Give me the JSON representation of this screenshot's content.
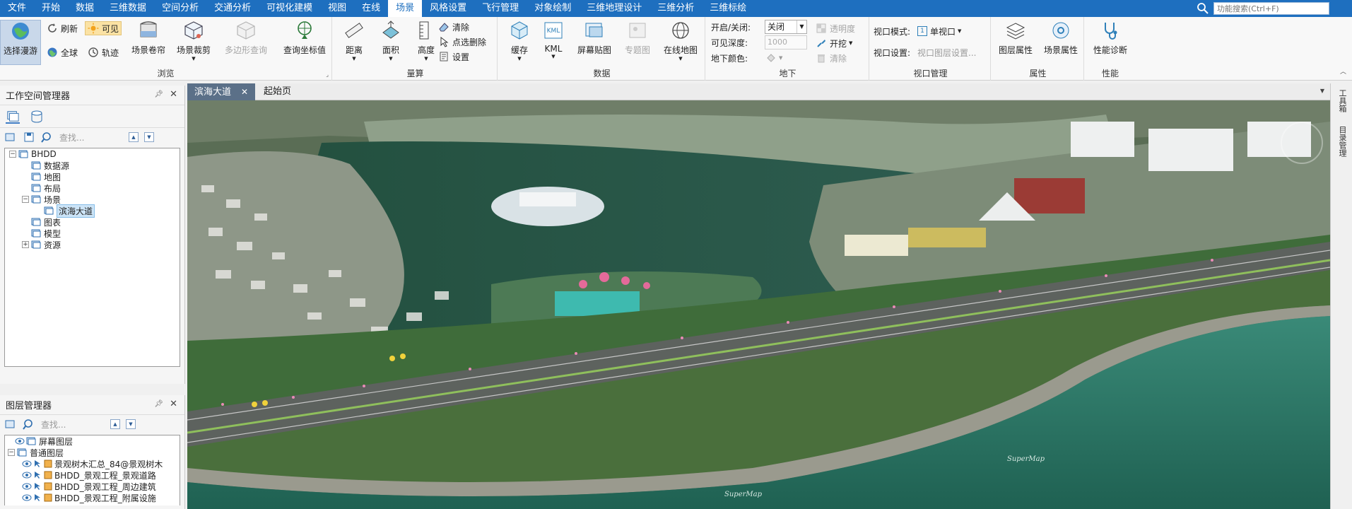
{
  "menubar": {
    "items": [
      "文件",
      "开始",
      "数据",
      "三维数据",
      "空间分析",
      "交通分析",
      "可视化建模",
      "视图",
      "在线",
      "场景",
      "风格设置",
      "飞行管理",
      "对象绘制",
      "三维地理设计",
      "三维分析",
      "三维标绘"
    ],
    "active": "场景",
    "search_placeholder": "功能搜索(Ctrl+F)"
  },
  "ribbon": {
    "browse": {
      "label": "浏览",
      "select_roam": "选择漫游",
      "refresh": "刷新",
      "visible": "可见",
      "full_extent": "全球",
      "track": "轨迹",
      "scene_roll": "场景卷帘",
      "scene_clip": "场景裁剪",
      "polygon_query": "多边形查询",
      "query_coord": "查询坐标值"
    },
    "measure": {
      "label": "量算",
      "distance": "距离",
      "area": "面积",
      "height": "高度",
      "clear": "清除",
      "point_delete": "点选删除",
      "settings": "设置"
    },
    "data": {
      "label": "数据",
      "cache": "缓存",
      "kml": "KML",
      "screen_map": "屏幕贴图",
      "theme_map": "专题图",
      "online_map": "在线地图"
    },
    "underground": {
      "label": "地下",
      "onoff_label": "开启/关闭:",
      "onoff_value": "关闭",
      "depth_label": "可见深度:",
      "depth_value": "1000",
      "color_label": "地下颜色:",
      "transparency": "透明度",
      "excavate": "开挖",
      "clear": "清除"
    },
    "viewport": {
      "label": "视口管理",
      "mode_label": "视口模式:",
      "mode_value": "单视口",
      "settings_label": "视口设置:",
      "settings_value": "视口图层设置..."
    },
    "properties": {
      "label": "属性",
      "layer_props": "图层属性",
      "scene_props": "场景属性"
    },
    "performance": {
      "label": "性能",
      "diagnose": "性能诊断"
    }
  },
  "workspace": {
    "title": "工作空间管理器",
    "find_placeholder": "查找...",
    "tree": [
      {
        "label": "BHDD",
        "level": 0,
        "expander": "−"
      },
      {
        "label": "数据源",
        "level": 1
      },
      {
        "label": "地图",
        "level": 1
      },
      {
        "label": "布局",
        "level": 1
      },
      {
        "label": "场景",
        "level": 1,
        "expander": "−"
      },
      {
        "label": "滨海大道",
        "level": 2,
        "selected": true
      },
      {
        "label": "图表",
        "level": 1
      },
      {
        "label": "模型",
        "level": 1
      },
      {
        "label": "资源",
        "level": 1,
        "expander": "+"
      }
    ]
  },
  "layers": {
    "title": "图层管理器",
    "find_placeholder": "查找...",
    "items": [
      {
        "label": "屏幕图层",
        "level": 1
      },
      {
        "label": "普通图层",
        "level": 0,
        "expander": "−"
      },
      {
        "label": "景观树木汇总_84@景观树木",
        "level": 2
      },
      {
        "label": "BHDD_景观工程_景观道路",
        "level": 2
      },
      {
        "label": "BHDD_景观工程_周边建筑",
        "level": 2
      },
      {
        "label": "BHDD_景观工程_附属设施",
        "level": 2
      }
    ]
  },
  "document": {
    "tabs": [
      {
        "label": "滨海大道",
        "active": true
      },
      {
        "label": "起始页",
        "active": false
      }
    ]
  },
  "right_strip": {
    "labels": [
      "工具箱",
      "目录管理"
    ]
  },
  "scene": {
    "watermark": "SuperMap"
  }
}
